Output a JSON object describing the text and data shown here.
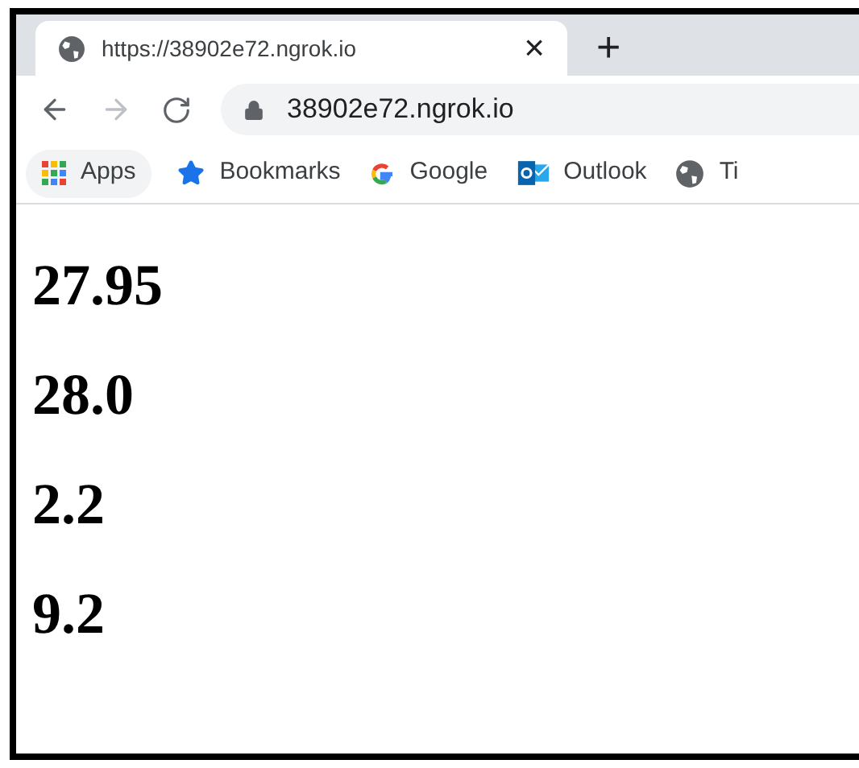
{
  "tab": {
    "title": "https://38902e72.ngrok.io",
    "close": "×",
    "new_tab": "+"
  },
  "address_bar": {
    "url": "38902e72.ngrok.io"
  },
  "bookmarks": [
    {
      "label": "Apps",
      "kind": "apps"
    },
    {
      "label": "Bookmarks",
      "kind": "star"
    },
    {
      "label": "Google",
      "kind": "google"
    },
    {
      "label": "Outlook",
      "kind": "outlook"
    },
    {
      "label": "Ti",
      "kind": "globe"
    }
  ],
  "headings": [
    "27.95",
    "28.0",
    "2.2",
    "9.2"
  ]
}
